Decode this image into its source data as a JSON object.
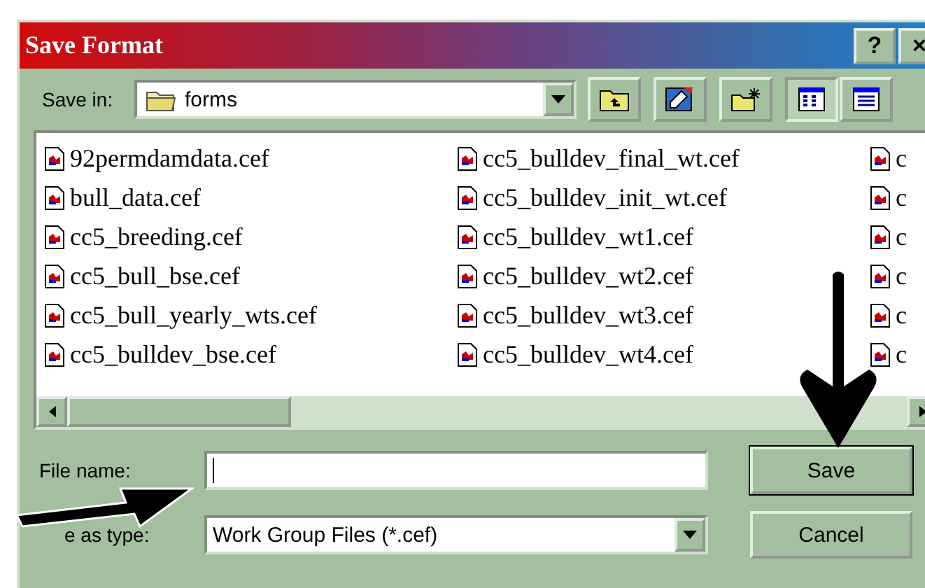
{
  "window": {
    "title": "Save Format",
    "title_buttons": [
      "?",
      "×"
    ]
  },
  "save_in": {
    "label": "Save in:",
    "value": "forms"
  },
  "toolbar": [
    {
      "kind": "up"
    },
    {
      "kind": "edit"
    },
    {
      "kind": "new-folder"
    },
    {
      "kind": "list",
      "selected": true
    },
    {
      "kind": "details",
      "selected": false
    }
  ],
  "files": [
    [
      {
        "name": "92permdamdata.cef"
      },
      {
        "name": "bull_data.cef"
      },
      {
        "name": "cc5_breeding.cef"
      },
      {
        "name": "cc5_bull_bse.cef"
      },
      {
        "name": "cc5_bull_yearly_wts.cef"
      },
      {
        "name": "cc5_bulldev_bse.cef"
      }
    ],
    [
      {
        "name": "cc5_bulldev_final_wt.cef"
      },
      {
        "name": "cc5_bulldev_init_wt.cef"
      },
      {
        "name": "cc5_bulldev_wt1.cef"
      },
      {
        "name": "cc5_bulldev_wt2.cef"
      },
      {
        "name": "cc5_bulldev_wt3.cef"
      },
      {
        "name": "cc5_bulldev_wt4.cef"
      }
    ],
    [
      {
        "name": "c"
      },
      {
        "name": "c"
      },
      {
        "name": "c"
      },
      {
        "name": "c"
      },
      {
        "name": "c"
      },
      {
        "name": "c"
      }
    ]
  ],
  "file_name": {
    "label": "File name:"
  },
  "save_as_type": {
    "label": "e as type:",
    "value": "Work Group Files (*.cef)"
  },
  "buttons": [
    "Save",
    "Cancel"
  ]
}
